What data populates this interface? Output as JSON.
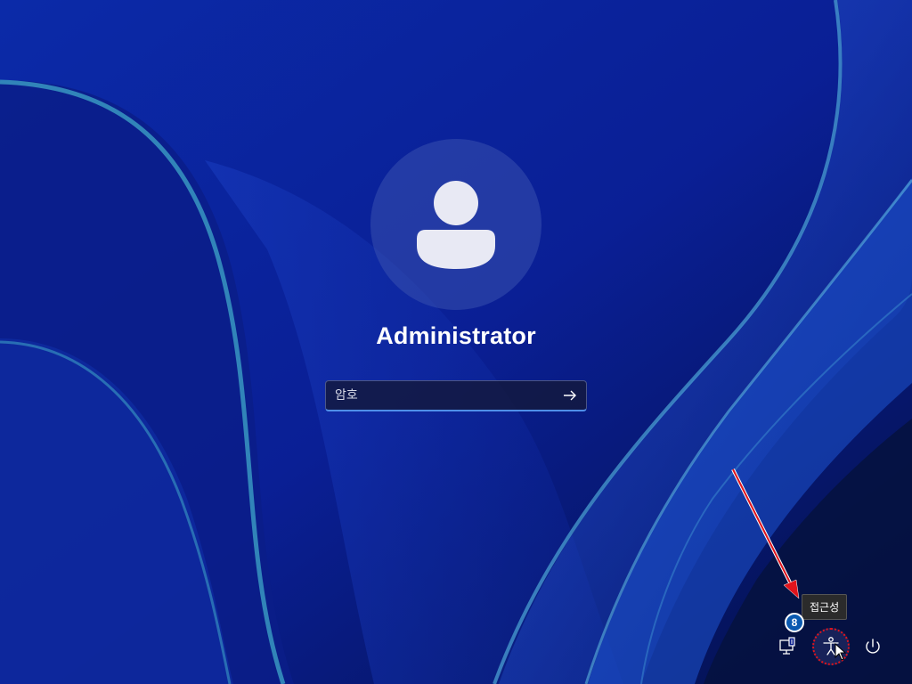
{
  "user": {
    "name": "Administrator",
    "avatar_icon": "user-avatar-icon"
  },
  "password": {
    "placeholder": "암호",
    "value": "",
    "submit_icon": "arrow-right-icon"
  },
  "tray": {
    "network_icon": "network-icon",
    "accessibility_icon": "accessibility-icon",
    "power_icon": "power-icon",
    "tooltip": "접근성"
  },
  "annotation": {
    "step_number": "8",
    "arrow_color": "#e0141c",
    "highlight_color": "#e0141c"
  },
  "colors": {
    "background": "#071a86",
    "accent": "#4f8fe8",
    "avatar_fill": "#e8e9f4"
  }
}
